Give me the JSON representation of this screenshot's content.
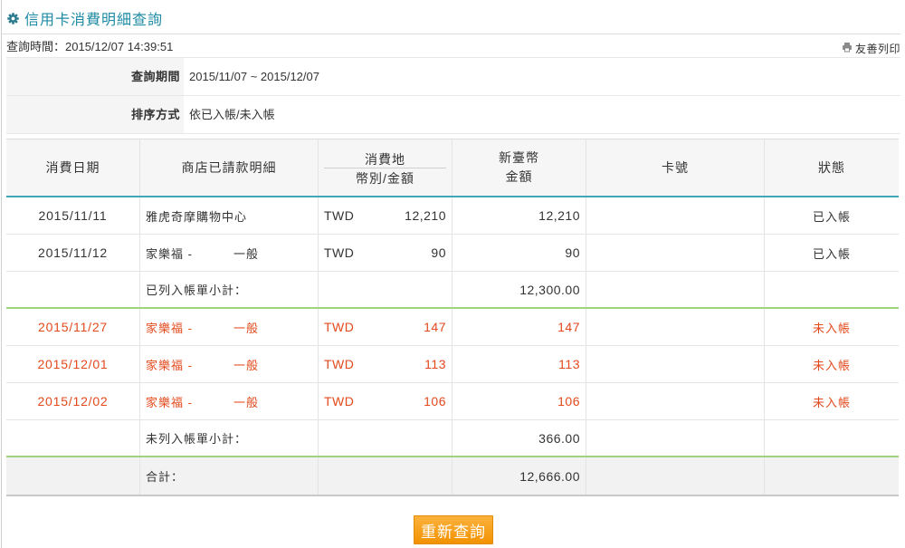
{
  "page_title": "信用卡消費明細查詢",
  "query_time": {
    "label": "查詢時間：",
    "value": "2015/12/07 14:39:51"
  },
  "print_label": "友善列印",
  "criteria": [
    {
      "label": "查詢期間",
      "value": "2015/11/07 ~ 2015/12/07"
    },
    {
      "label": "排序方式",
      "value": "依已入帳/未入帳"
    }
  ],
  "table": {
    "headers": {
      "date": "消費日期",
      "store": "商店已請款明細",
      "location": "消費地",
      "currency_amount": "幣別/金額",
      "twd_line1": "新臺幣",
      "twd_line2": "金額",
      "card": "卡號",
      "status": "狀態"
    },
    "posted": [
      {
        "date": "2015/11/11",
        "store": "雅虎奇摩購物中心",
        "currency": "TWD",
        "amount": "12,210",
        "twd": "12,210",
        "status": "已入帳"
      },
      {
        "date": "2015/11/12",
        "store": "家樂福 -",
        "store_note": "一般",
        "currency": "TWD",
        "amount": "90",
        "twd": "90",
        "status": "已入帳"
      }
    ],
    "posted_subtotal": {
      "label": "已列入帳單小計：",
      "value": "12,300.00"
    },
    "unposted": [
      {
        "date": "2015/11/27",
        "store": "家樂福 -",
        "store_note": "一般",
        "currency": "TWD",
        "amount": "147",
        "twd": "147",
        "status": "未入帳"
      },
      {
        "date": "2015/12/01",
        "store": "家樂福 -",
        "store_note": "一般",
        "currency": "TWD",
        "amount": "113",
        "twd": "113",
        "status": "未入帳"
      },
      {
        "date": "2015/12/02",
        "store": "家樂福 -",
        "store_note": "一般",
        "currency": "TWD",
        "amount": "106",
        "twd": "106",
        "status": "未入帳"
      }
    ],
    "unposted_subtotal": {
      "label": "未列入帳單小計：",
      "value": "366.00"
    },
    "total": {
      "label": "合計：",
      "value": "12,666.00"
    }
  },
  "requery_button": "重新查詢",
  "icons": {
    "title": "gear-icon",
    "print": "printer-icon"
  },
  "colors": {
    "accent": "#1d8ba3",
    "header_underline": "#3fa7b9",
    "unposted_text": "#e3491c",
    "subtotal_divider": "#9fd47f",
    "button": "#f6a01c"
  }
}
